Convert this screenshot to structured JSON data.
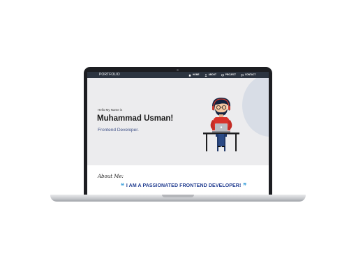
{
  "site": {
    "logo": "PORTFOLIO",
    "nav": [
      {
        "label": "HOME",
        "icon": "home-icon"
      },
      {
        "label": "ABOUT",
        "icon": "user-icon"
      },
      {
        "label": "PROJECT",
        "icon": "monitor-icon"
      },
      {
        "label": "CONTACT",
        "icon": "chat-icon"
      }
    ]
  },
  "hero": {
    "greeting": "Hello My Name is",
    "name": "Muhammad Usman!",
    "role": "Frontend Developer."
  },
  "about": {
    "title": "About Me:",
    "tagline": "I AM A PASSIONATED FRONTEND DEVELOPER!",
    "quote_open": "❝",
    "quote_close": "❞"
  },
  "colors": {
    "nav_bg": "#2c3440",
    "hero_bg": "#ececee",
    "accent_blue": "#1f3b8f",
    "quote_blue": "#4aa7df",
    "laptop_bezel": "#1d1e22"
  }
}
